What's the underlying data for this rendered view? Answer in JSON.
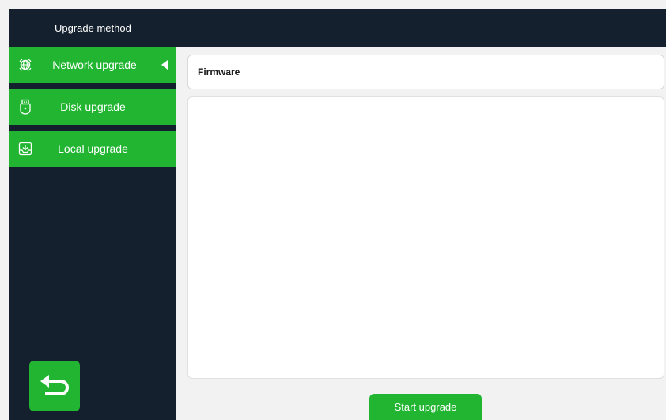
{
  "header": {
    "title": "Upgrade method"
  },
  "sidebar": {
    "items": [
      {
        "label": "Network upgrade",
        "icon": "network-globe-icon",
        "active": true
      },
      {
        "label": "Disk upgrade",
        "icon": "usb-disk-icon",
        "active": false
      },
      {
        "label": "Local upgrade",
        "icon": "local-download-icon",
        "active": false
      }
    ],
    "back_icon": "back-arrow-icon"
  },
  "main": {
    "firmware_label": "Firmware",
    "start_button_label": "Start upgrade"
  },
  "colors": {
    "accent": "#22b532",
    "dark_panel": "#15202e",
    "background": "#f2f2f2"
  }
}
